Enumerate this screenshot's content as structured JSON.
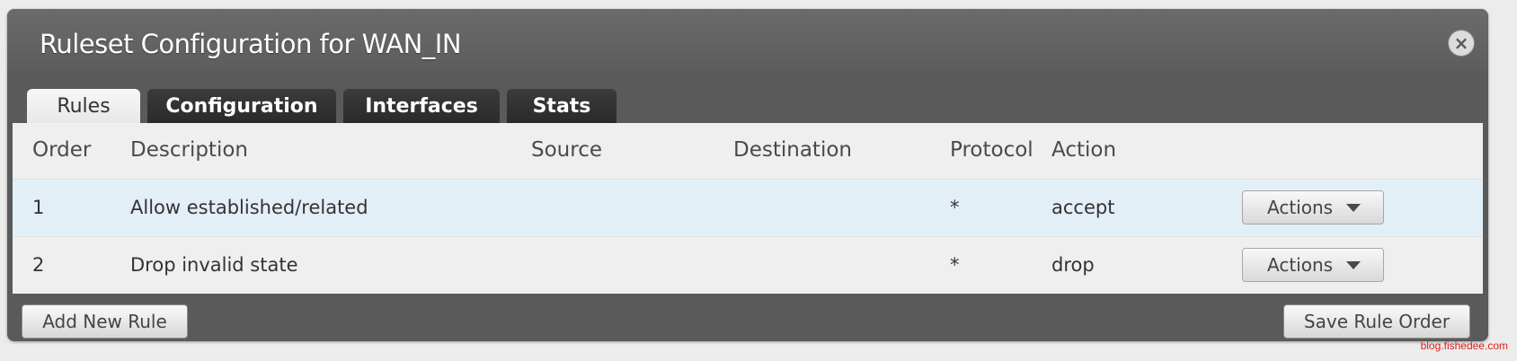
{
  "dialog": {
    "title": "Ruleset Configuration for WAN_IN",
    "close_icon": "close-icon"
  },
  "tabs": [
    {
      "label": "Rules",
      "active": true
    },
    {
      "label": "Configuration",
      "active": false
    },
    {
      "label": "Interfaces",
      "active": false
    },
    {
      "label": "Stats",
      "active": false
    }
  ],
  "table": {
    "columns": [
      "Order",
      "Description",
      "Source",
      "Destination",
      "Protocol",
      "Action"
    ],
    "rows": [
      {
        "order": "1",
        "description": "Allow established/related",
        "source": "",
        "destination": "",
        "protocol": "*",
        "action": "accept",
        "actions_label": "Actions"
      },
      {
        "order": "2",
        "description": "Drop invalid state",
        "source": "",
        "destination": "",
        "protocol": "*",
        "action": "drop",
        "actions_label": "Actions"
      }
    ]
  },
  "footer": {
    "add_rule_label": "Add New Rule",
    "save_order_label": "Save Rule Order"
  },
  "watermark": "blog.fishedee.com",
  "colors": {
    "dialog_bg": "#5a5a5a",
    "selected_row": "#e3eff7",
    "tab_dark": "#2e2e2e"
  }
}
